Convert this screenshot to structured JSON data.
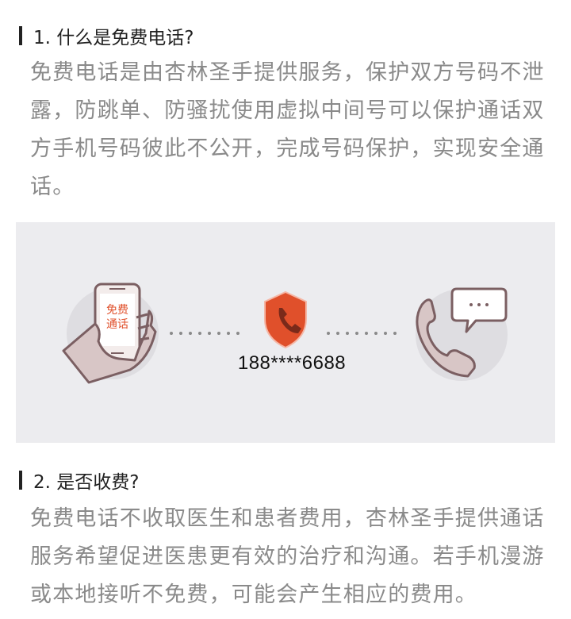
{
  "section1": {
    "title": "1. 什么是免费电话?",
    "text": "免费电话是由杏林圣手提供服务，保护双方号码不泄露，防跳单、防骚扰使用虚拟中间号可以保护通话双方手机号码彼此不公开，完成号码保护，实现安全通话。"
  },
  "illustration": {
    "phone_screen_text_line1": "免费",
    "phone_screen_text_line2": "通话",
    "virtual_number": "188****6688",
    "accent_color": "#e0502b",
    "banner_bg": "#ececef"
  },
  "section2": {
    "title": "2. 是否收费?",
    "text": "免费电话不收取医生和患者费用，杏林圣手提供通话服务希望促进医患更有效的治疗和沟通。若手机漫游或本地接听不免费，可能会产生相应的费用。"
  }
}
